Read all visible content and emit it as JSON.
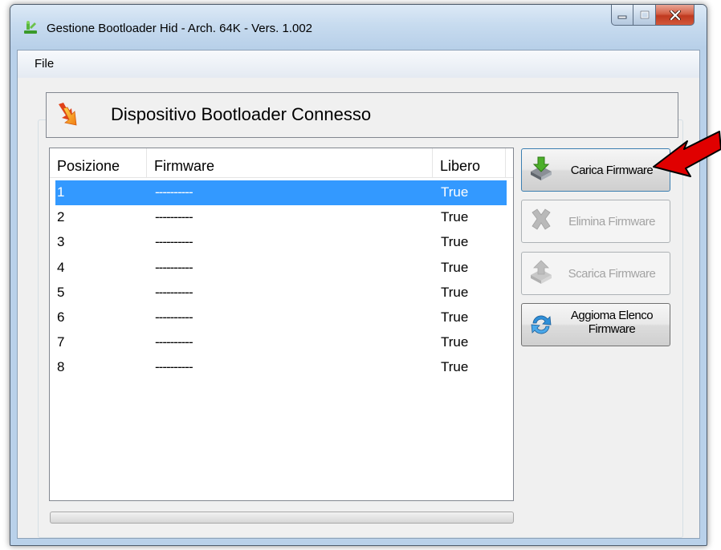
{
  "window": {
    "title": "Gestione Bootloader Hid - Arch. 64K - Vers. 1.002"
  },
  "menu": {
    "file_label": "File"
  },
  "status": {
    "text": "Dispositivo Bootloader Connesso"
  },
  "list": {
    "columns": [
      "Posizione",
      "Firmware",
      "Libero"
    ],
    "rows": [
      {
        "pos": "1",
        "firmware": "----------",
        "free": "True",
        "selected": true
      },
      {
        "pos": "2",
        "firmware": "----------",
        "free": "True"
      },
      {
        "pos": "3",
        "firmware": "----------",
        "free": "True"
      },
      {
        "pos": "4",
        "firmware": "----------",
        "free": "True"
      },
      {
        "pos": "5",
        "firmware": "----------",
        "free": "True"
      },
      {
        "pos": "6",
        "firmware": "----------",
        "free": "True"
      },
      {
        "pos": "7",
        "firmware": "----------",
        "free": "True"
      },
      {
        "pos": "8",
        "firmware": "----------",
        "free": "True"
      }
    ]
  },
  "buttons": {
    "carica": "Carica Firmware",
    "elimina": "Elimina Firmware",
    "scarica": "Scarica Firmware",
    "aggiorna_line1": "Aggioma Elenco",
    "aggiorna_line2": "Firmware"
  },
  "colors": {
    "selection": "#3399ff",
    "annotation_arrow": "#e00000"
  },
  "icons": {
    "app": "app-icon",
    "status": "bootloader-arrow-icon",
    "carica": "download-icon",
    "elimina": "delete-x-icon",
    "scarica": "upload-icon",
    "aggiorna": "refresh-icon"
  }
}
